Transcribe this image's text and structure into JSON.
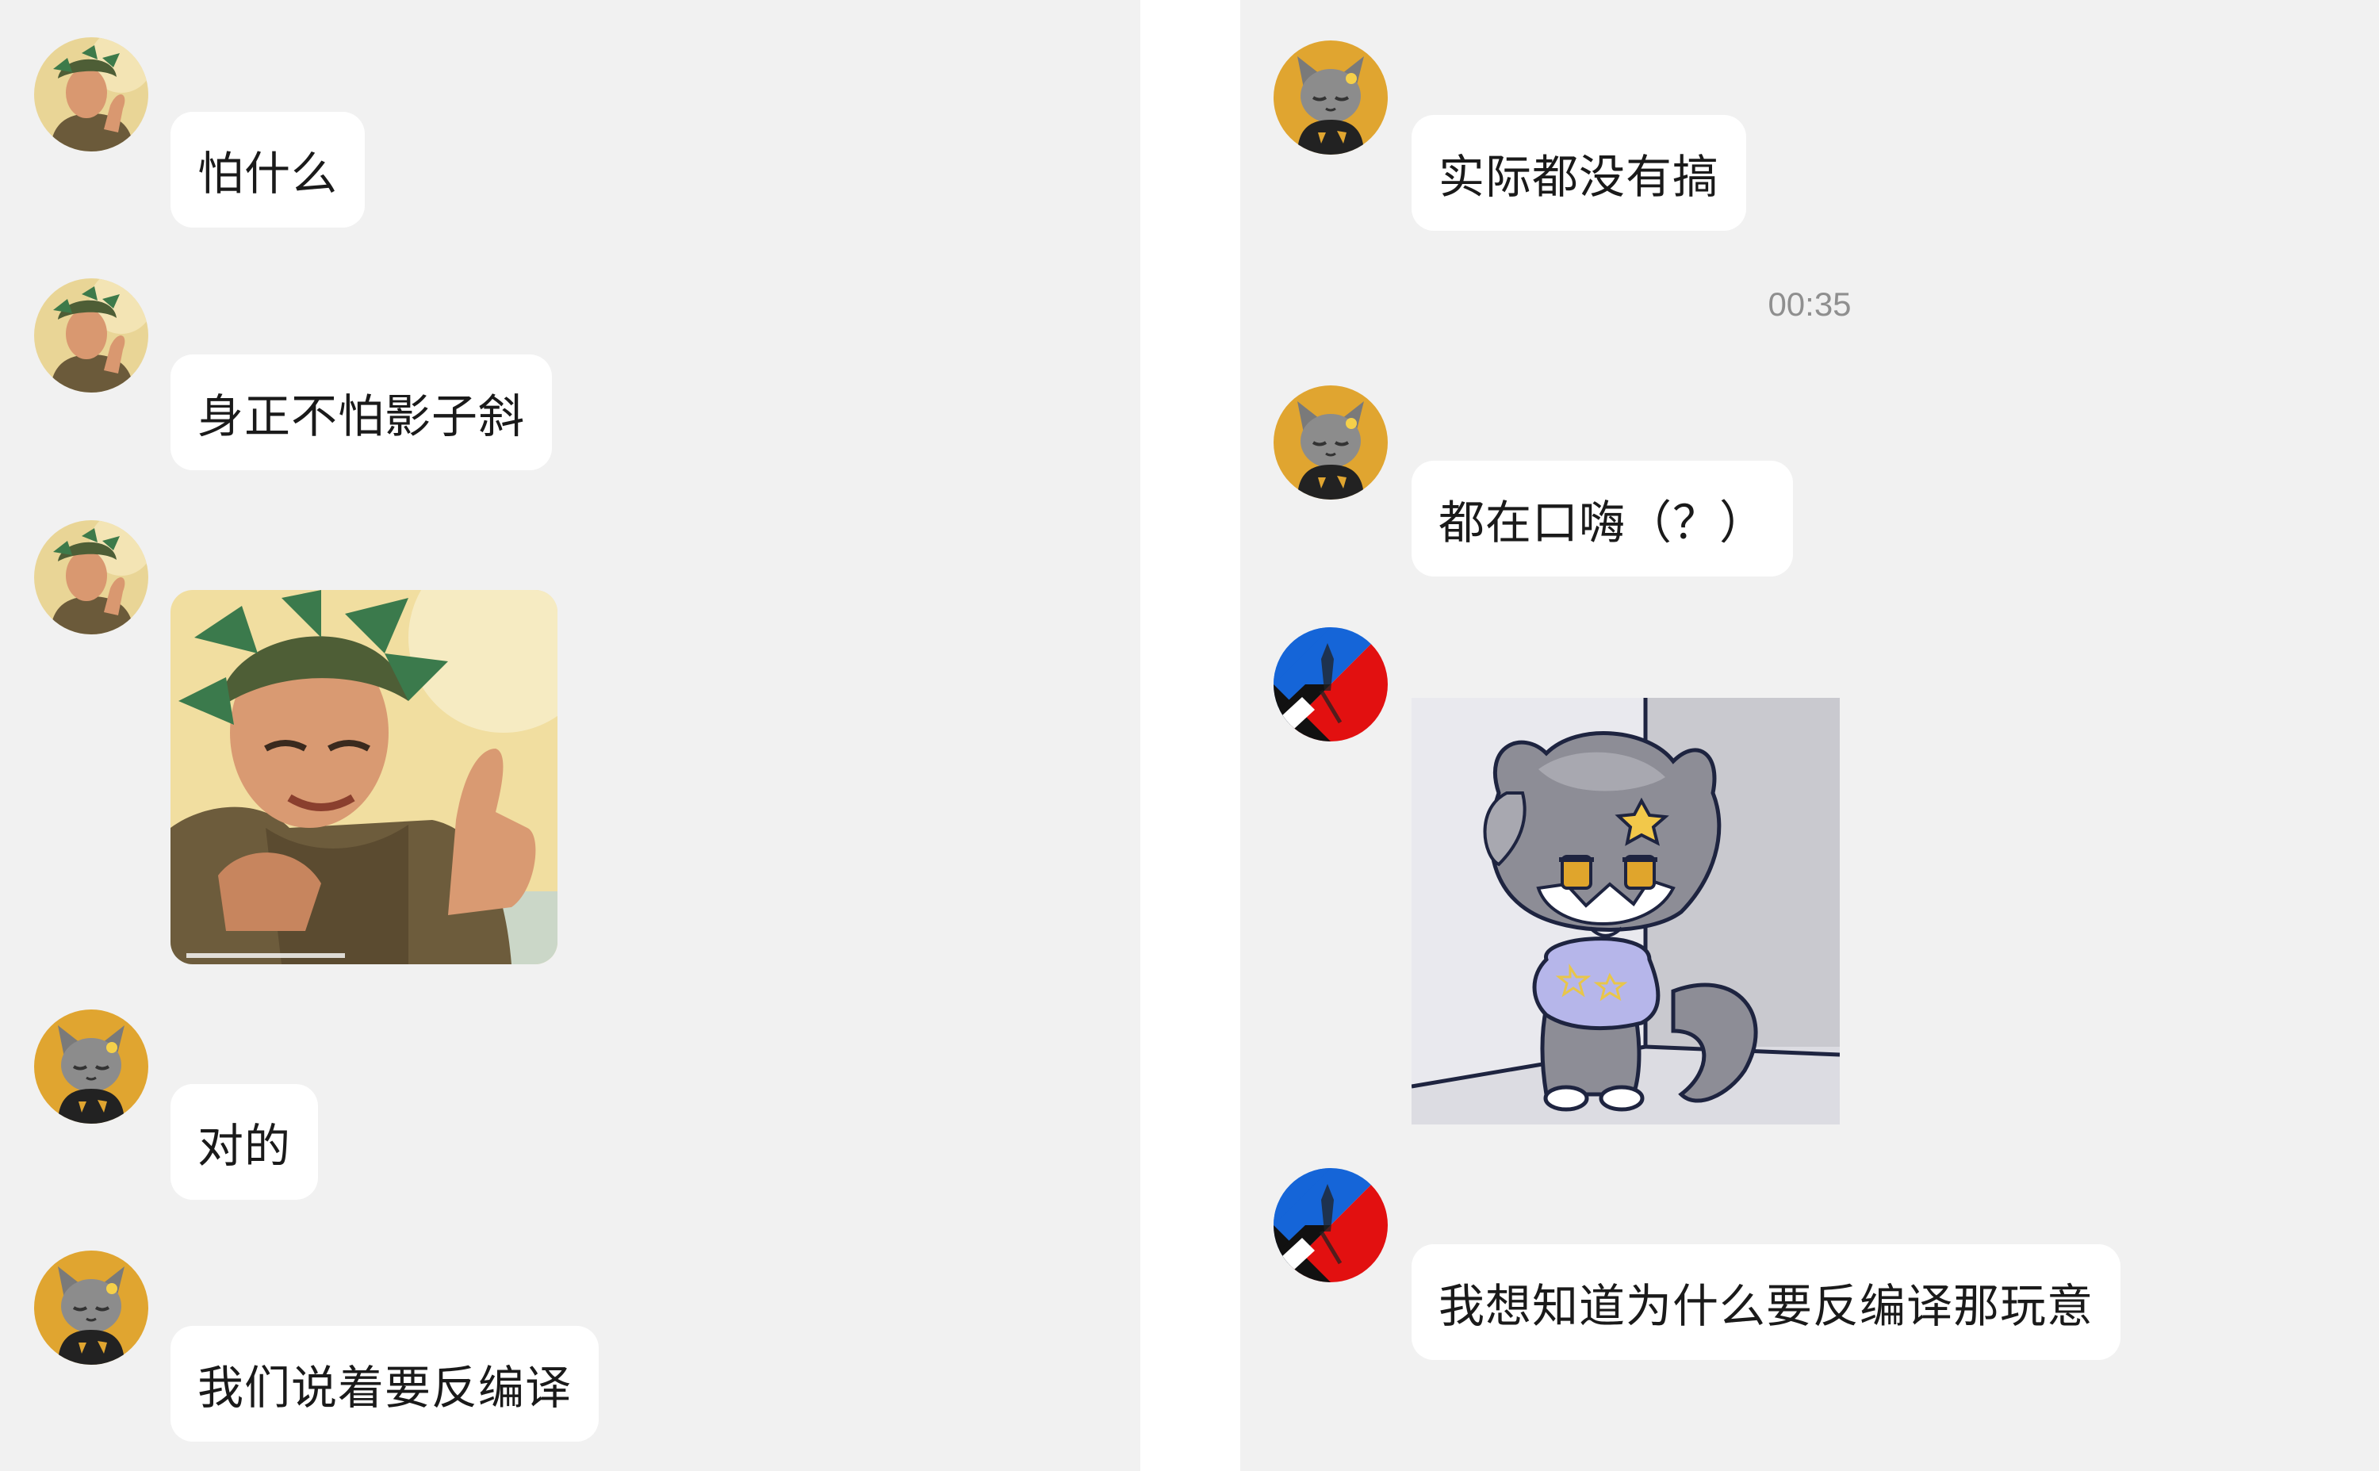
{
  "left_panel": {
    "messages": [
      {
        "sender": "soldier",
        "type": "text",
        "text": "怕什么"
      },
      {
        "sender": "soldier",
        "type": "text",
        "text": "身正不怕影子斜"
      },
      {
        "sender": "soldier",
        "type": "image",
        "image_icon": "thumbs-up-soldier-meme"
      },
      {
        "sender": "grey-cat",
        "type": "text",
        "text": "对的"
      },
      {
        "sender": "grey-cat",
        "type": "text",
        "text": "我们说着要反编译"
      }
    ]
  },
  "right_panel": {
    "messages": [
      {
        "sender": "grey-cat",
        "type": "text",
        "text": "实际都没有搞"
      },
      {
        "type": "timestamp",
        "text": "00:35"
      },
      {
        "sender": "grey-cat",
        "type": "text",
        "text": "都在口嗨（？）"
      },
      {
        "sender": "flag-user",
        "type": "image",
        "image_icon": "chibi-wolf-sticker"
      },
      {
        "sender": "flag-user",
        "type": "text",
        "text": "我想知道为什么要反编译那玩意"
      }
    ]
  },
  "colors": {
    "chat_background": "#f1f1f1",
    "divider": "#ffffff",
    "bubble": "#ffffff",
    "text": "#1a1a1a",
    "timestamp": "#8f8f8f",
    "cat_avatar_bg": "#e0a530",
    "flag_blue": "#1565d8",
    "flag_red": "#e21010"
  }
}
